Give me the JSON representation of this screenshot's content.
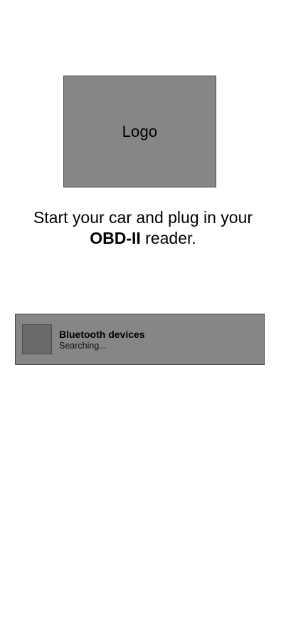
{
  "logo": {
    "label": "Logo"
  },
  "instruction": {
    "line1": "Start your car and plug in your",
    "emphasis": "OBD-II",
    "line2_rest": " reader."
  },
  "bluetooth": {
    "title": "Bluetooth devices",
    "status": "Searching..."
  },
  "colors": {
    "placeholder_fill": "#868686",
    "thumb_fill": "#6b6b6b",
    "border": "#4a4a4a"
  }
}
